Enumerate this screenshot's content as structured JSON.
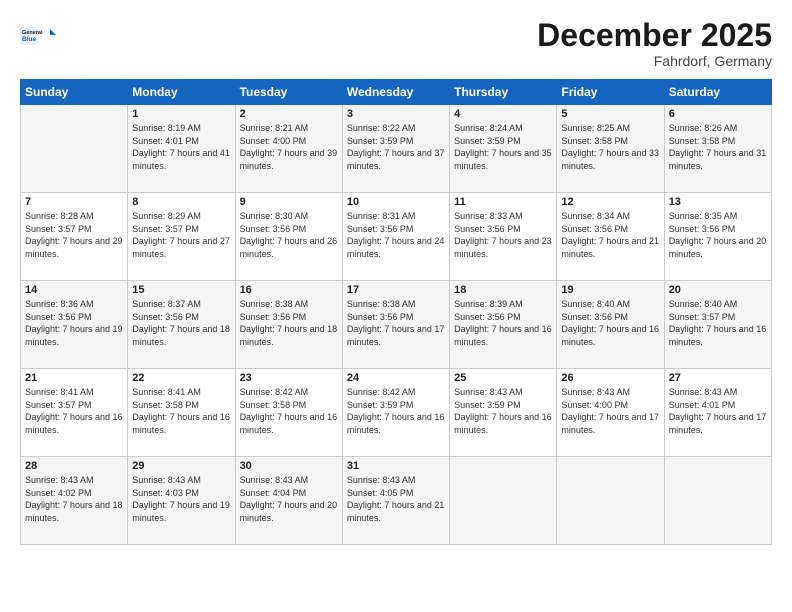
{
  "header": {
    "logo_line1": "General",
    "logo_line2": "Blue",
    "month": "December 2025",
    "location": "Fahrdorf, Germany"
  },
  "days_of_week": [
    "Sunday",
    "Monday",
    "Tuesday",
    "Wednesday",
    "Thursday",
    "Friday",
    "Saturday"
  ],
  "weeks": [
    [
      {
        "day": "",
        "sunrise": "",
        "sunset": "",
        "daylight": ""
      },
      {
        "day": "1",
        "sunrise": "Sunrise: 8:19 AM",
        "sunset": "Sunset: 4:01 PM",
        "daylight": "Daylight: 7 hours and 41 minutes."
      },
      {
        "day": "2",
        "sunrise": "Sunrise: 8:21 AM",
        "sunset": "Sunset: 4:00 PM",
        "daylight": "Daylight: 7 hours and 39 minutes."
      },
      {
        "day": "3",
        "sunrise": "Sunrise: 8:22 AM",
        "sunset": "Sunset: 3:59 PM",
        "daylight": "Daylight: 7 hours and 37 minutes."
      },
      {
        "day": "4",
        "sunrise": "Sunrise: 8:24 AM",
        "sunset": "Sunset: 3:59 PM",
        "daylight": "Daylight: 7 hours and 35 minutes."
      },
      {
        "day": "5",
        "sunrise": "Sunrise: 8:25 AM",
        "sunset": "Sunset: 3:58 PM",
        "daylight": "Daylight: 7 hours and 33 minutes."
      },
      {
        "day": "6",
        "sunrise": "Sunrise: 8:26 AM",
        "sunset": "Sunset: 3:58 PM",
        "daylight": "Daylight: 7 hours and 31 minutes."
      }
    ],
    [
      {
        "day": "7",
        "sunrise": "Sunrise: 8:28 AM",
        "sunset": "Sunset: 3:57 PM",
        "daylight": "Daylight: 7 hours and 29 minutes."
      },
      {
        "day": "8",
        "sunrise": "Sunrise: 8:29 AM",
        "sunset": "Sunset: 3:57 PM",
        "daylight": "Daylight: 7 hours and 27 minutes."
      },
      {
        "day": "9",
        "sunrise": "Sunrise: 8:30 AM",
        "sunset": "Sunset: 3:56 PM",
        "daylight": "Daylight: 7 hours and 26 minutes."
      },
      {
        "day": "10",
        "sunrise": "Sunrise: 8:31 AM",
        "sunset": "Sunset: 3:56 PM",
        "daylight": "Daylight: 7 hours and 24 minutes."
      },
      {
        "day": "11",
        "sunrise": "Sunrise: 8:33 AM",
        "sunset": "Sunset: 3:56 PM",
        "daylight": "Daylight: 7 hours and 23 minutes."
      },
      {
        "day": "12",
        "sunrise": "Sunrise: 8:34 AM",
        "sunset": "Sunset: 3:56 PM",
        "daylight": "Daylight: 7 hours and 21 minutes."
      },
      {
        "day": "13",
        "sunrise": "Sunrise: 8:35 AM",
        "sunset": "Sunset: 3:56 PM",
        "daylight": "Daylight: 7 hours and 20 minutes."
      }
    ],
    [
      {
        "day": "14",
        "sunrise": "Sunrise: 8:36 AM",
        "sunset": "Sunset: 3:56 PM",
        "daylight": "Daylight: 7 hours and 19 minutes."
      },
      {
        "day": "15",
        "sunrise": "Sunrise: 8:37 AM",
        "sunset": "Sunset: 3:56 PM",
        "daylight": "Daylight: 7 hours and 18 minutes."
      },
      {
        "day": "16",
        "sunrise": "Sunrise: 8:38 AM",
        "sunset": "Sunset: 3:56 PM",
        "daylight": "Daylight: 7 hours and 18 minutes."
      },
      {
        "day": "17",
        "sunrise": "Sunrise: 8:38 AM",
        "sunset": "Sunset: 3:56 PM",
        "daylight": "Daylight: 7 hours and 17 minutes."
      },
      {
        "day": "18",
        "sunrise": "Sunrise: 8:39 AM",
        "sunset": "Sunset: 3:56 PM",
        "daylight": "Daylight: 7 hours and 16 minutes."
      },
      {
        "day": "19",
        "sunrise": "Sunrise: 8:40 AM",
        "sunset": "Sunset: 3:56 PM",
        "daylight": "Daylight: 7 hours and 16 minutes."
      },
      {
        "day": "20",
        "sunrise": "Sunrise: 8:40 AM",
        "sunset": "Sunset: 3:57 PM",
        "daylight": "Daylight: 7 hours and 16 minutes."
      }
    ],
    [
      {
        "day": "21",
        "sunrise": "Sunrise: 8:41 AM",
        "sunset": "Sunset: 3:57 PM",
        "daylight": "Daylight: 7 hours and 16 minutes."
      },
      {
        "day": "22",
        "sunrise": "Sunrise: 8:41 AM",
        "sunset": "Sunset: 3:58 PM",
        "daylight": "Daylight: 7 hours and 16 minutes."
      },
      {
        "day": "23",
        "sunrise": "Sunrise: 8:42 AM",
        "sunset": "Sunset: 3:58 PM",
        "daylight": "Daylight: 7 hours and 16 minutes."
      },
      {
        "day": "24",
        "sunrise": "Sunrise: 8:42 AM",
        "sunset": "Sunset: 3:59 PM",
        "daylight": "Daylight: 7 hours and 16 minutes."
      },
      {
        "day": "25",
        "sunrise": "Sunrise: 8:43 AM",
        "sunset": "Sunset: 3:59 PM",
        "daylight": "Daylight: 7 hours and 16 minutes."
      },
      {
        "day": "26",
        "sunrise": "Sunrise: 8:43 AM",
        "sunset": "Sunset: 4:00 PM",
        "daylight": "Daylight: 7 hours and 17 minutes."
      },
      {
        "day": "27",
        "sunrise": "Sunrise: 8:43 AM",
        "sunset": "Sunset: 4:01 PM",
        "daylight": "Daylight: 7 hours and 17 minutes."
      }
    ],
    [
      {
        "day": "28",
        "sunrise": "Sunrise: 8:43 AM",
        "sunset": "Sunset: 4:02 PM",
        "daylight": "Daylight: 7 hours and 18 minutes."
      },
      {
        "day": "29",
        "sunrise": "Sunrise: 8:43 AM",
        "sunset": "Sunset: 4:03 PM",
        "daylight": "Daylight: 7 hours and 19 minutes."
      },
      {
        "day": "30",
        "sunrise": "Sunrise: 8:43 AM",
        "sunset": "Sunset: 4:04 PM",
        "daylight": "Daylight: 7 hours and 20 minutes."
      },
      {
        "day": "31",
        "sunrise": "Sunrise: 8:43 AM",
        "sunset": "Sunset: 4:05 PM",
        "daylight": "Daylight: 7 hours and 21 minutes."
      },
      {
        "day": "",
        "sunrise": "",
        "sunset": "",
        "daylight": ""
      },
      {
        "day": "",
        "sunrise": "",
        "sunset": "",
        "daylight": ""
      },
      {
        "day": "",
        "sunrise": "",
        "sunset": "",
        "daylight": ""
      }
    ]
  ]
}
